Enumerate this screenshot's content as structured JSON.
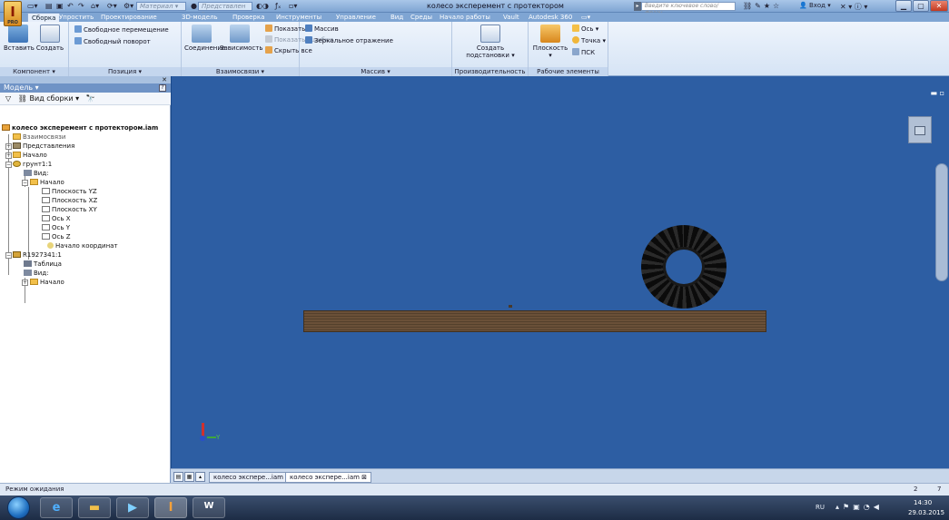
{
  "window": {
    "title": "колесо эксперемент с протектором",
    "material_box": "Материал",
    "appearance_box": "Предстввлен",
    "search_placeholder": "Введите ключевое слово/фразу",
    "login": "Вход",
    "app_letter": "I",
    "app_edition": "PRO"
  },
  "tabs": [
    "Сборка",
    "Упростить",
    "Проектирование",
    "3D-модель",
    "Проверка",
    "Инструменты",
    "Управление",
    "Вид",
    "Среды",
    "Начало работы",
    "Vault",
    "Autodesk 360"
  ],
  "ribbon": {
    "component": {
      "label": "Компонент",
      "insert": "Вставить",
      "create": "Создать"
    },
    "position": {
      "label": "Позиция",
      "free_move": "Свободное перемещение",
      "free_rotate": "Свободный поворот"
    },
    "relations": {
      "label": "Взаимосвязи",
      "joint": "Соединение",
      "constraint": "Зависимость",
      "show": "Показать",
      "show_errors": "Показать ошибки",
      "hide_all": "Скрыть все"
    },
    "pattern": {
      "label": "Массив",
      "pattern": "Массив",
      "mirror": "Зеркальное отражение"
    },
    "productivity": {
      "label": "Производительность",
      "create_sub_1": "Создать",
      "create_sub_2": "подстановки"
    },
    "work_features": {
      "label": "Рабочие элементы",
      "plane": "Плоскость",
      "axis": "Ось",
      "point": "Точка",
      "ucs": "ПСК"
    }
  },
  "browser": {
    "title": "Модель",
    "view_mode": "Вид сборки",
    "items": [
      {
        "label": "колесо эксперемент с протектором.iam"
      },
      {
        "label": "Взаимосвязи"
      },
      {
        "label": "Представления"
      },
      {
        "label": "Начало"
      },
      {
        "label": "грунт1:1"
      },
      {
        "label": "Вид:"
      },
      {
        "label": "Начало"
      },
      {
        "label": "Плоскость YZ"
      },
      {
        "label": "Плоскость XZ"
      },
      {
        "label": "Плоскость XY"
      },
      {
        "label": "Ось X"
      },
      {
        "label": "Ось Y"
      },
      {
        "label": "Ось Z"
      },
      {
        "label": "Начало координат"
      },
      {
        "label": "R1927341:1"
      },
      {
        "label": "Таблица"
      },
      {
        "label": "Вид:"
      },
      {
        "label": "Начало"
      }
    ]
  },
  "viewport": {
    "axis_label": "Y"
  },
  "doc_tabs": [
    "колесо эксперe...iam",
    "колесо экспере...iam"
  ],
  "status": {
    "text": "Режим ожидания",
    "count1": "2",
    "count2": "7"
  },
  "taskbar": {
    "lang": "RU",
    "time": "14:30",
    "date": "29.03.2015"
  },
  "colors": {
    "viewport_bg": "#2d5ea3",
    "ribbon_bg": "#e6eefa",
    "tab_bar": "#7fa5d3"
  }
}
